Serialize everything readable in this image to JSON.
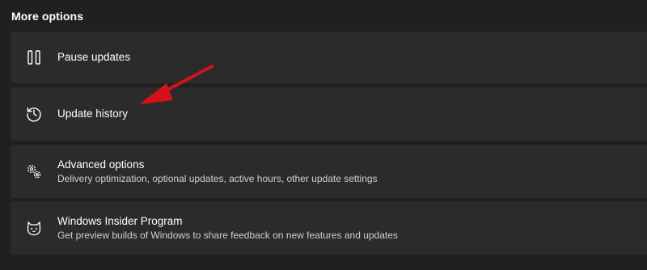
{
  "section": {
    "title": "More options"
  },
  "options": [
    {
      "icon": "pause-icon",
      "title": "Pause updates",
      "description": ""
    },
    {
      "icon": "history-icon",
      "title": "Update history",
      "description": ""
    },
    {
      "icon": "gears-icon",
      "title": "Advanced options",
      "description": "Delivery optimization, optional updates, active hours, other update settings"
    },
    {
      "icon": "insider-cat-icon",
      "title": "Windows Insider Program",
      "description": "Get preview builds of Windows to share feedback on new features and updates"
    }
  ],
  "annotation": {
    "arrow_color": "#d4121b"
  },
  "colors": {
    "background": "#202020",
    "card": "#2b2b2b",
    "text": "#ffffff",
    "subtext": "#cfcfcf"
  }
}
